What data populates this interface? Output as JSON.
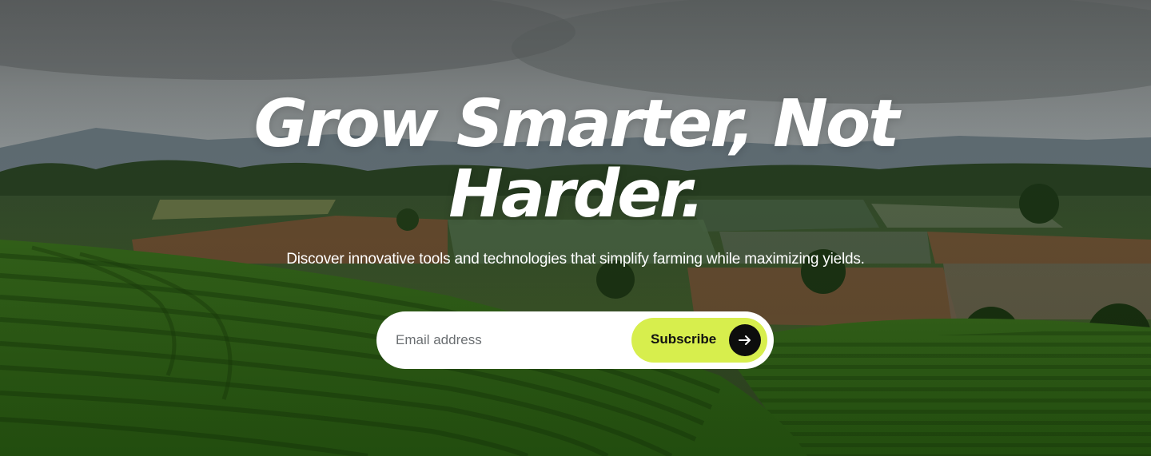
{
  "hero": {
    "headline": "Grow Smarter, Not Harder.",
    "subtitle": "Discover innovative tools and technologies that simplify farming while maximizing yields."
  },
  "signup": {
    "email_placeholder": "Email address",
    "email_value": "",
    "subscribe_label": "Subscribe",
    "subscribe_icon": "arrow-right-icon"
  },
  "colors": {
    "accent": "#d7ee4d",
    "icon_bg": "#0d0d0d",
    "text": "#ffffff"
  }
}
